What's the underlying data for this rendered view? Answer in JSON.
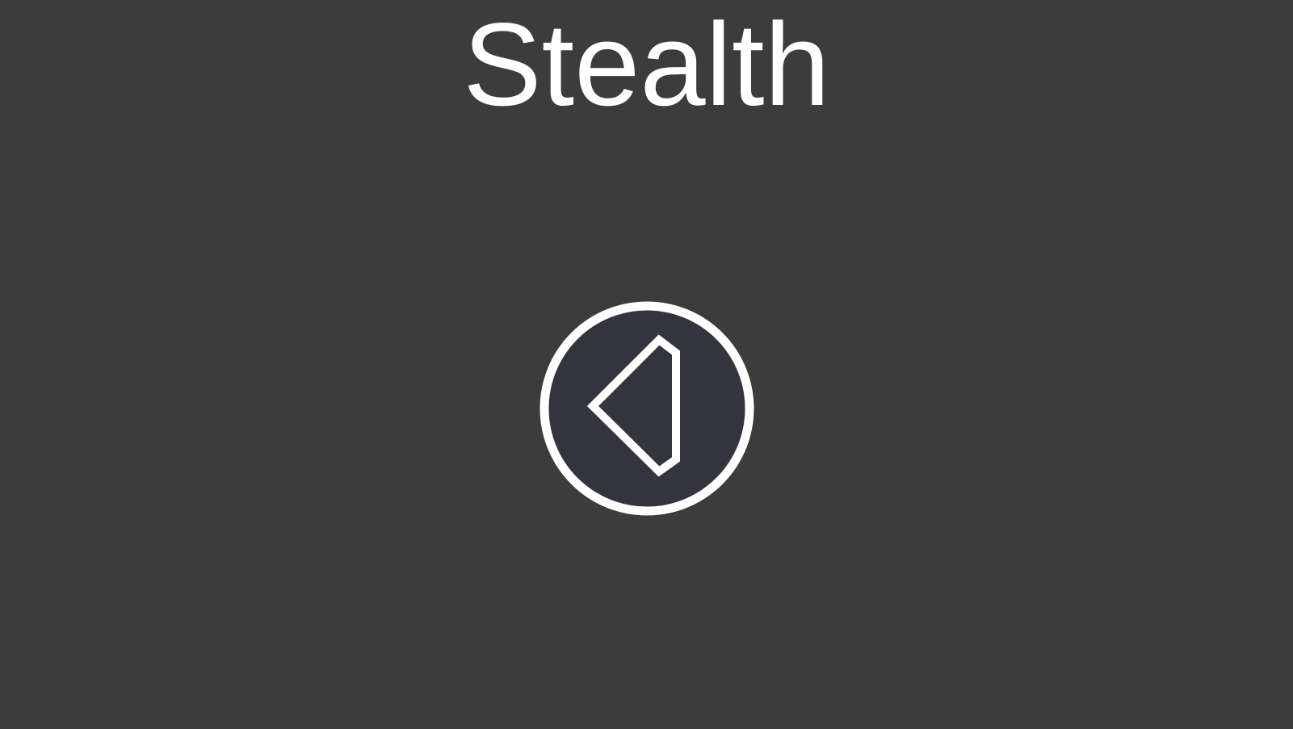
{
  "screen": {
    "background_color": "#3c3c3c"
  },
  "title": {
    "text": "Stealth",
    "color": "#ffffff"
  },
  "back_button": {
    "icon": "back-triangle-icon",
    "fill_color": "#33343c",
    "stroke_color": "#ffffff"
  }
}
